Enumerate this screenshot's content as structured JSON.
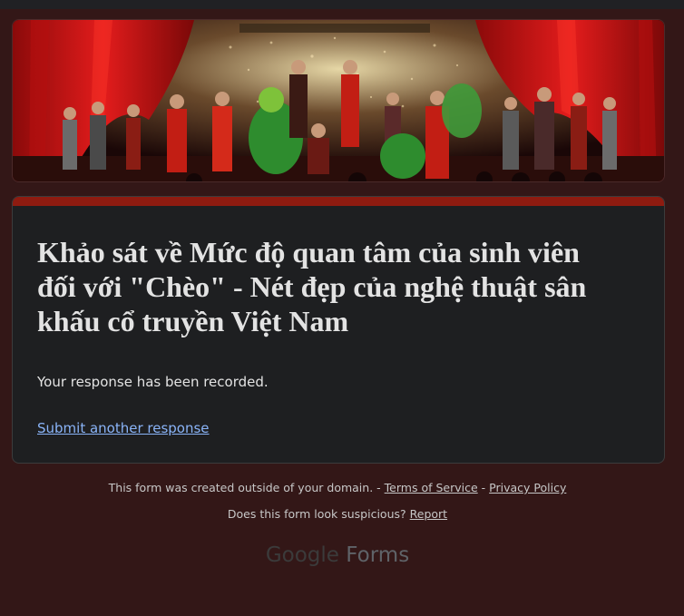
{
  "form": {
    "title": "Khảo sát về Mức độ quan tâm của sinh viên đối với \"Chèo\" - Nét đẹp của nghệ thuật sân khấu cổ truyền Việt Nam",
    "confirmation": "Your response has been recorded.",
    "another_link": "Submit another response"
  },
  "footer": {
    "notice": "This form was created outside of your domain. -",
    "terms": "Terms of Service",
    "separator": "-",
    "privacy": "Privacy Policy",
    "suspicious": "Does this form look suspicious?",
    "report": "Report"
  },
  "brand": {
    "google": "Google",
    "forms": "Forms"
  },
  "colors": {
    "page_bg": "#331717",
    "card_bg": "#1e1f21",
    "accent": "#8e1b10",
    "link": "#8ab4f8"
  }
}
